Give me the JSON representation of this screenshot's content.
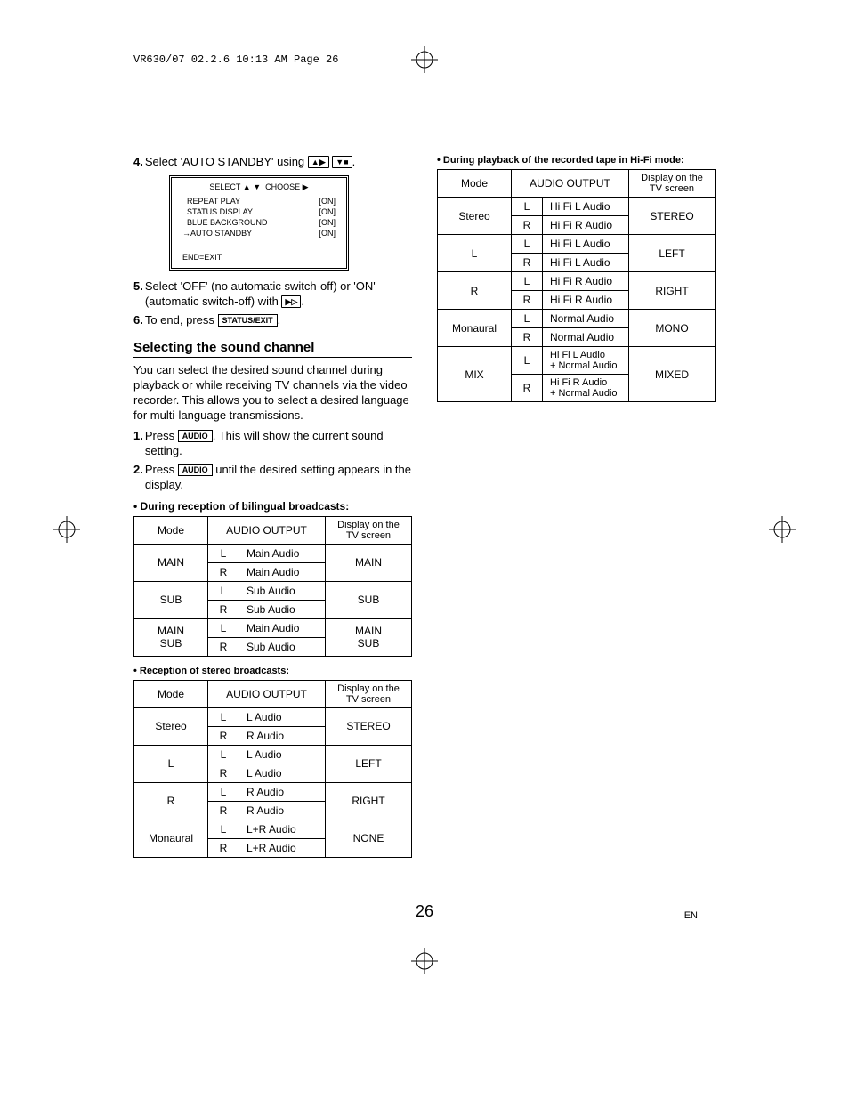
{
  "header": "VR630/07  02.2.6  10:13 AM  Page 26",
  "step4": {
    "num": "4.",
    "text_a": "Select 'AUTO STANDBY' using ",
    "text_b": "."
  },
  "osd": {
    "header_left": "SELECT",
    "header_right": "CHOOSE",
    "rows": [
      {
        "label": "  REPEAT PLAY",
        "val": "[ON]"
      },
      {
        "label": "  STATUS DISPLAY",
        "val": "[ON]"
      },
      {
        "label": "  BLUE BACKGROUND",
        "val": "[ON]"
      },
      {
        "label": "→AUTO STANDBY",
        "val": "[ON]"
      }
    ],
    "end": "END=EXIT"
  },
  "step5": {
    "num": "5.",
    "text_a": "Select 'OFF' (no automatic switch-off) or 'ON' (automatic switch-off) with ",
    "text_b": "."
  },
  "step6": {
    "num": "6.",
    "text_a": "To end, press ",
    "key": "STATUS/EXIT",
    "text_b": "."
  },
  "section_heading": "Selecting the sound channel",
  "section_para": "You can select the desired sound channel during playback or while receiving TV channels via the video recorder. This allows you to select a desired language for multi-language transmissions.",
  "s1": {
    "num": "1.",
    "a": "Press ",
    "key": "AUDIO",
    "b": ". This will show the current sound setting."
  },
  "s2": {
    "num": "2.",
    "a": "Press ",
    "key": "AUDIO",
    "b": " until the desired setting appears in the display."
  },
  "t1_caption": "• During reception of bilingual broadcasts:",
  "table_headers": {
    "mode": "Mode",
    "audio_output": "AUDIO OUTPUT",
    "display": "Display on the TV screen",
    "L": "L",
    "R": "R"
  },
  "t1": [
    {
      "mode": "MAIN",
      "L": "Main Audio",
      "R": "Main Audio",
      "disp": "MAIN"
    },
    {
      "mode": "SUB",
      "L": "Sub Audio",
      "R": "Sub Audio",
      "disp": "SUB"
    },
    {
      "mode": "MAIN SUB",
      "L": "Main Audio",
      "R": "Sub Audio",
      "disp": "MAIN SUB",
      "disp_two_line": true,
      "mode_two_line": true
    }
  ],
  "t2_caption": "• Reception of stereo broadcasts:",
  "t2": [
    {
      "mode": "Stereo",
      "L": "L Audio",
      "R": "R Audio",
      "disp": "STEREO"
    },
    {
      "mode": "L",
      "L": "L Audio",
      "R": "L Audio",
      "disp": "LEFT"
    },
    {
      "mode": "R",
      "L": "R Audio",
      "R": "R Audio",
      "disp": "RIGHT"
    },
    {
      "mode": "Monaural",
      "L": "L+R Audio",
      "R": "L+R Audio",
      "disp": "NONE"
    }
  ],
  "t3_caption": "• During playback of the recorded tape in Hi-Fi mode:",
  "t3": [
    {
      "mode": "Stereo",
      "L": "Hi Fi L Audio",
      "R": "Hi Fi R Audio",
      "disp": "STEREO"
    },
    {
      "mode": "L",
      "L": "Hi Fi L Audio",
      "R": "Hi Fi L Audio",
      "disp": "LEFT"
    },
    {
      "mode": "R",
      "L": "Hi Fi R Audio",
      "R": "Hi Fi R Audio",
      "disp": "RIGHT"
    },
    {
      "mode": "Monaural",
      "L": "Normal Audio",
      "R": "Normal Audio",
      "disp": "MONO"
    },
    {
      "mode": "MIX",
      "L": "Hi Fi L Audio + Normal Audio",
      "R": "Hi Fi R Audio + Normal Audio",
      "disp": "MIXED"
    }
  ],
  "page_number": "26",
  "lang_mark": "EN",
  "glyphs": {
    "up_play": "▲▶",
    "down_stop": "▼■",
    "play_ff": "▶▷",
    "tri_up": "▲",
    "tri_down": "▼",
    "tri_right": "▶"
  }
}
